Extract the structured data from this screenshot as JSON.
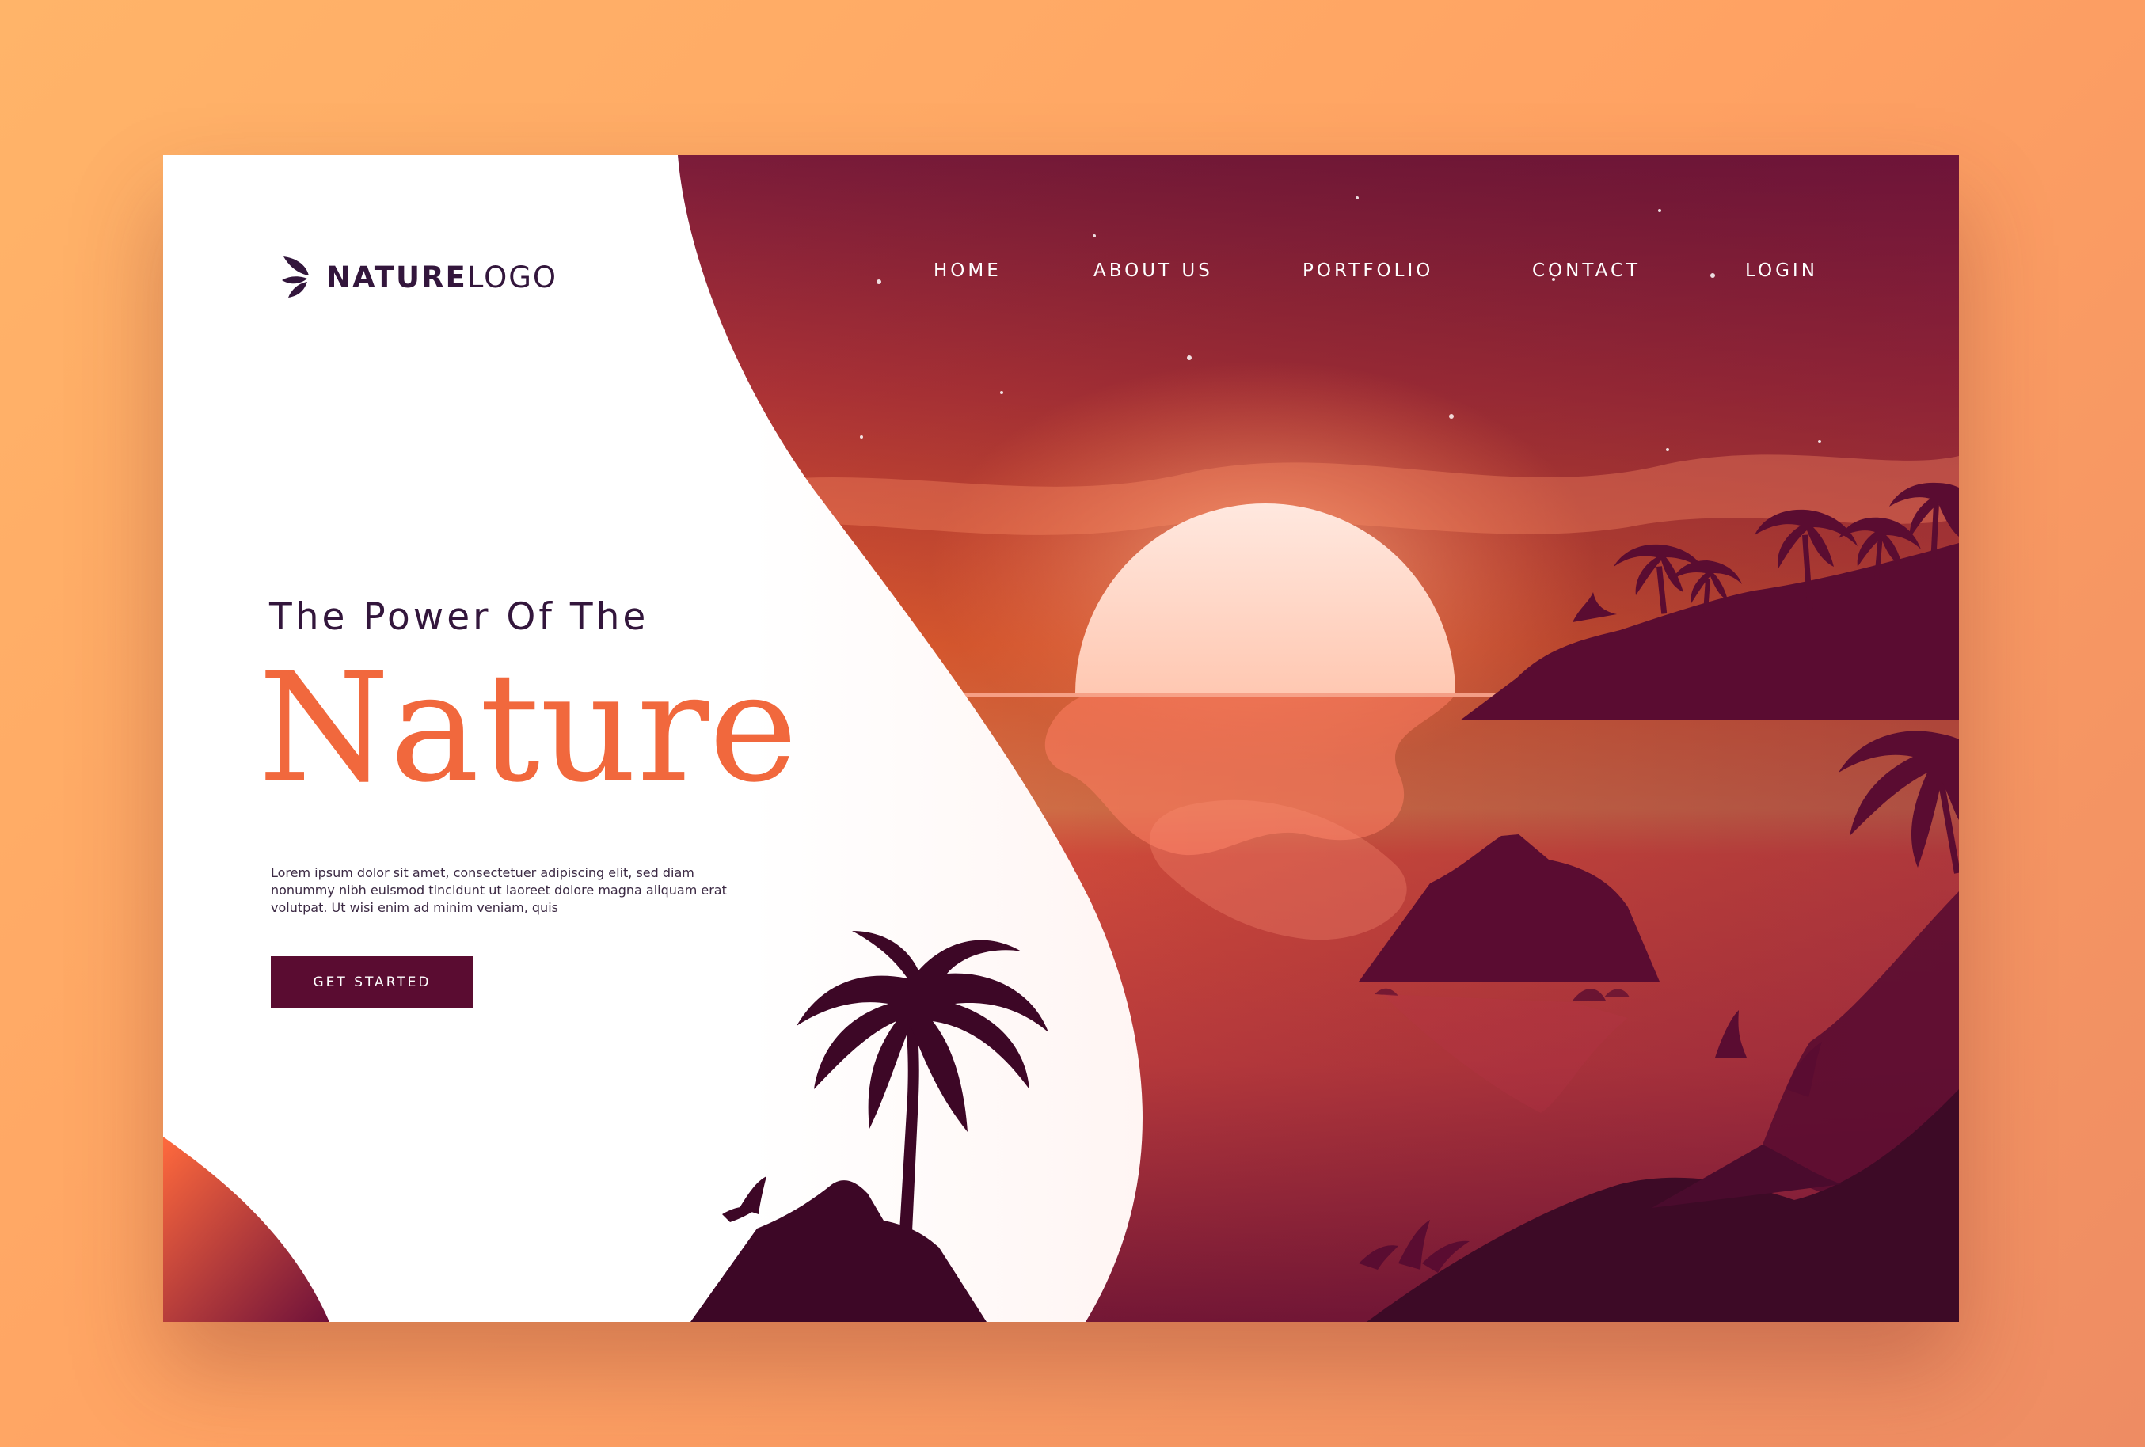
{
  "logo": {
    "bold": "NATURE",
    "light": "LOGO",
    "icon": "leaf-icon"
  },
  "nav": {
    "items": [
      "HOME",
      "ABOUT US",
      "PORTFOLIO",
      "CONTACT",
      "LOGIN"
    ]
  },
  "hero": {
    "subtitle": "The Power Of The",
    "title": "Nature",
    "body": "Lorem ipsum dolor sit amet, consectetuer adipiscing elit, sed diam nonummy nibh euismod tincidunt ut laoreet dolore magna aliquam erat volutpat. Ut wisi enim ad minim veniam, quis",
    "cta_label": "GET STARTED"
  },
  "colors": {
    "background": "#ffa866",
    "accent": "#f1683d",
    "dark": "#33163c",
    "button": "#5a0c31",
    "silhouette": "#5a0c31",
    "sky_top": "#7c1a42",
    "sky_horizon": "#ff6a33",
    "sun": "#ffd9cc"
  }
}
